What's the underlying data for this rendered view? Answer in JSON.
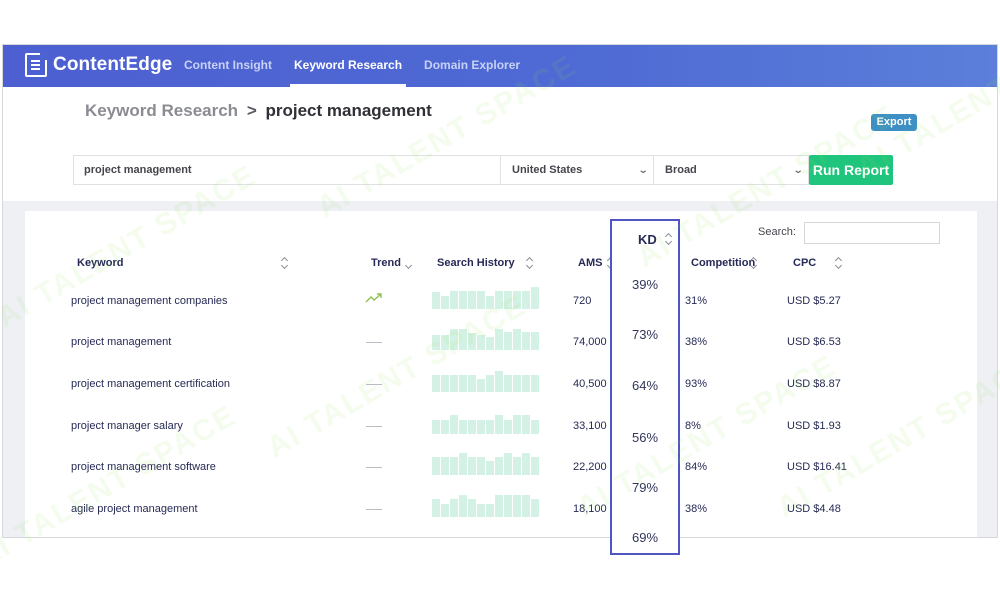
{
  "app": {
    "brand": "ContentEdge",
    "brand_icon": "document-logo-icon",
    "nav": [
      {
        "label": "Content Insight",
        "active": false
      },
      {
        "label": "Keyword Research",
        "active": true
      },
      {
        "label": "Domain Explorer",
        "active": false
      }
    ]
  },
  "breadcrumb": {
    "parent": "Keyword Research",
    "separator": ">",
    "current": "project management"
  },
  "toolbar": {
    "export_label": "Export",
    "keyword_value": "project management",
    "country_value": "United States",
    "match_value": "Broad",
    "run_label": "Run Report"
  },
  "table": {
    "search_label": "Search:",
    "search_value": "",
    "columns": {
      "keyword": "Keyword",
      "trend": "Trend",
      "history": "Search History",
      "ams": "AMS",
      "kd": "KD",
      "competition": "Competition",
      "cpc": "CPC"
    },
    "rows": [
      {
        "keyword": "project management companies",
        "trend": "up",
        "history": [
          0.75,
          0.6,
          0.8,
          0.8,
          0.8,
          0.8,
          0.6,
          0.8,
          0.8,
          0.8,
          0.8,
          1.0
        ],
        "ams": "720",
        "kd": "39%",
        "competition": "31%",
        "cpc": "USD $5.27"
      },
      {
        "keyword": "project management",
        "trend": "flat",
        "history": [
          0.7,
          0.7,
          0.95,
          0.95,
          0.75,
          0.7,
          0.6,
          0.95,
          0.8,
          0.95,
          0.8,
          0.8
        ],
        "ams": "74,000",
        "kd": "73%",
        "competition": "38%",
        "cpc": "USD $6.53"
      },
      {
        "keyword": "project management certification",
        "trend": "flat",
        "history": [
          0.75,
          0.75,
          0.75,
          0.75,
          0.75,
          0.6,
          0.75,
          0.95,
          0.75,
          0.75,
          0.75,
          0.75
        ],
        "ams": "40,500",
        "kd": "64%",
        "competition": "93%",
        "cpc": "USD $8.87"
      },
      {
        "keyword": "project manager salary",
        "trend": "flat",
        "history": [
          0.65,
          0.65,
          0.85,
          0.65,
          0.65,
          0.65,
          0.65,
          0.85,
          0.65,
          0.85,
          0.85,
          0.65
        ],
        "ams": "33,100",
        "kd": "56%",
        "competition": "8%",
        "cpc": "USD $1.93"
      },
      {
        "keyword": "project management software",
        "trend": "flat",
        "history": [
          0.8,
          0.8,
          0.8,
          1.0,
          0.8,
          0.8,
          0.65,
          0.8,
          1.0,
          0.8,
          1.0,
          0.8
        ],
        "ams": "22,200",
        "kd": "79%",
        "competition": "84%",
        "cpc": "USD $16.41"
      },
      {
        "keyword": "agile project management",
        "trend": "flat",
        "history": [
          0.8,
          0.6,
          0.8,
          1.0,
          0.8,
          0.6,
          0.6,
          1.0,
          1.0,
          1.0,
          1.0,
          0.8
        ],
        "ams": "18,100",
        "kd": "69%",
        "competition": "38%",
        "cpc": "USD $4.48"
      }
    ]
  },
  "watermark": "AI TALENT SPACE"
}
